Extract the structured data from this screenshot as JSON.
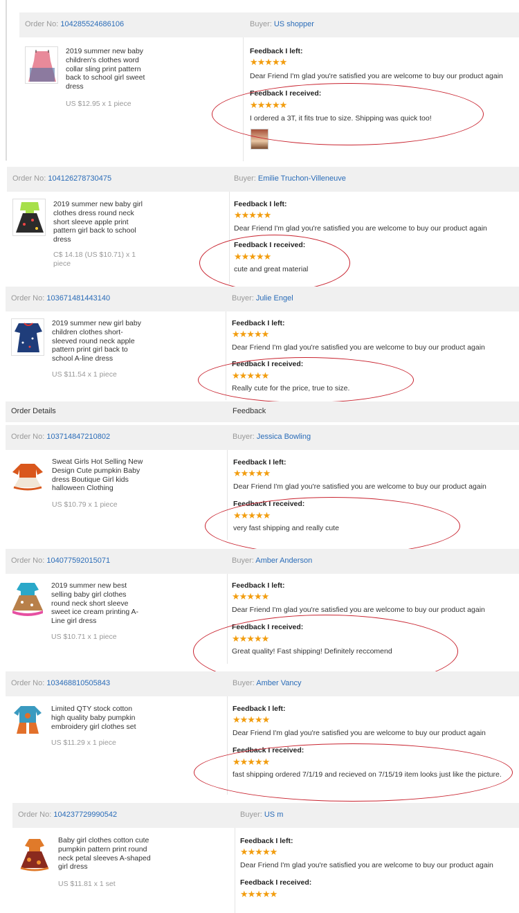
{
  "orders": [
    {
      "order_label": "Order No:",
      "order_no": "104285524686106",
      "buyer_label": "Buyer:",
      "buyer": "US shopper",
      "title": "2019 summer new baby children's clothes word collar sling print pattern back to school girl sweet dress",
      "price": "US $12.95 x 1 piece",
      "left_label": "Feedback I left:",
      "left_stars": "★★★★★",
      "left_text": "Dear Friend I'm glad you're satisfied you are welcome to buy our product again",
      "received_label": "Feedback I received:",
      "received_stars": "★★★★★",
      "received_text": "I ordered a 3T, it fits true to size. Shipping was quick too!"
    },
    {
      "order_label": "Order No:",
      "order_no": "104126278730475",
      "buyer_label": "Buyer:",
      "buyer": "Emilie Truchon-Villeneuve",
      "title": "2019 summer new baby girl clothes dress round neck short sleeve apple print pattern girl back to school dress",
      "price": "C$ 14.18 (US $10.71) x 1 piece",
      "left_label": "Feedback I left:",
      "left_stars": "★★★★★",
      "left_text": "Dear Friend I'm glad you're satisfied you are welcome to buy our product again",
      "received_label": "Feedback I received:",
      "received_stars": "★★★★★",
      "received_text": "cute and great material"
    },
    {
      "order_label": "Order No:",
      "order_no": "103671481443140",
      "buyer_label": "Buyer:",
      "buyer": "Julie Engel",
      "title": "2019 summer new girl baby children clothes short-sleeved round neck apple pattern print girl back to school A-line dress",
      "price": "US $11.54 x 1 piece",
      "left_label": "Feedback I left:",
      "left_stars": "★★★★★",
      "left_text": "Dear Friend I'm glad you're satisfied you are welcome to buy our product again",
      "received_label": "Feedback I received:",
      "received_stars": "★★★★★",
      "received_text": "Really cute for the price, true to size."
    },
    {
      "order_label": "Order No:",
      "order_no": "103714847210802",
      "buyer_label": "Buyer:",
      "buyer": "Jessica Bowling",
      "title": "Sweat Girls Hot Selling New Design Cute pumpkin Baby dress Boutique Girl kids halloween Clothing",
      "price": "US $10.79 x 1 piece",
      "left_label": "Feedback I left:",
      "left_stars": "★★★★★",
      "left_text": "Dear Friend I'm glad you're satisfied you are welcome to buy our product again",
      "received_label": "Feedback I received:",
      "received_stars": "★★★★★",
      "received_text": "very fast shipping and really cute"
    },
    {
      "order_label": "Order No:",
      "order_no": "104077592015071",
      "buyer_label": "Buyer:",
      "buyer": "Amber Anderson",
      "title": "2019 summer new best selling baby girl clothes round neck short sleeve sweet ice cream printing A-Line girl dress",
      "price": "US $10.71 x 1 piece",
      "left_label": "Feedback I left:",
      "left_stars": "★★★★★",
      "left_text": "Dear Friend I'm glad you're satisfied you are welcome to buy our product again",
      "received_label": "Feedback I received:",
      "received_stars": "★★★★★",
      "received_text": "Great quality! Fast shipping! Definitely reccomend"
    },
    {
      "order_label": "Order No:",
      "order_no": "103468810505843",
      "buyer_label": "Buyer:",
      "buyer": "Amber Vancy",
      "title": "Limited QTY stock cotton high quality baby pumpkin embroidery girl clothes set",
      "price": "US $11.29 x 1 piece",
      "left_label": "Feedback I left:",
      "left_stars": "★★★★★",
      "left_text": "Dear Friend I'm glad you're satisfied you are welcome to buy our product again",
      "received_label": "Feedback I received:",
      "received_stars": "★★★★★",
      "received_text": "fast shipping ordered 7/1/19 and recieved on 7/15/19 item looks just like the picture."
    },
    {
      "order_label": "Order No:",
      "order_no": "104237729990542",
      "buyer_label": "Buyer:",
      "buyer": "US m",
      "title": "Baby girl clothes cotton cute pumpkin pattern print round neck petal sleeves A-shaped girl dress",
      "price": "US $11.81 x 1 set",
      "left_label": "Feedback I left:",
      "left_stars": "★★★★★",
      "left_text": "Dear Friend I'm glad you're satisfied you are welcome to buy our product again",
      "received_label": "Feedback I received:",
      "received_stars": "★★★★★"
    }
  ],
  "header_band": {
    "order_details": "Order Details",
    "feedback": "Feedback"
  },
  "colors": {
    "link": "#2a6cb8",
    "star": "#f29d0f",
    "highlight_ellipse": "#c8222e",
    "header_bg": "#f0f0f0"
  }
}
